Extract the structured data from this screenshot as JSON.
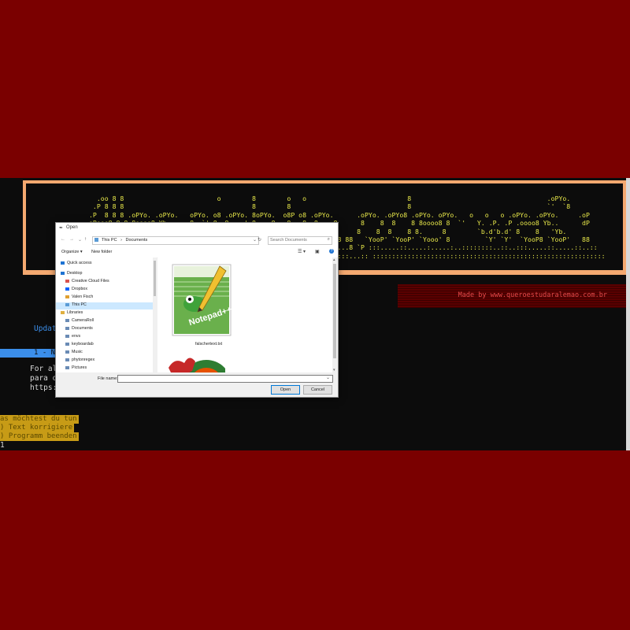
{
  "terminal": {
    "banner_lines": [
      "  .oo 8 8                        o        8        o   o                          8                                   .oPYo.",
      " .P 8 8 8                                 8        8                              8                                   `'  `8",
      ".P  8 8 8 .oPYo. .oPYo.   oPYo. o8 .oPYo. 8oPYo.  o8P o8 .oPYo.      .oPYo. .oPYo8 .oPYo. oPYo.   o   o   o .oPYo. .oPYo.     .oP",
      "oPooo8 8 8 8oooo8 Yb..    8  `' 8  8    ' 8    8   8   8  8    8      8    8  8    8 8oooo8 8  `'   Y. .P. .P .oooo8 Yb..      dP",
      ".P    8 8 8 8.     'Yb.  8     8  8    . 8    8   8   8  8    8      8    8  8    8 8.     8        `b.d'b.d' 8    8   'Yb.",
      ".P     8 8 8 `Yooo' `YooP' 8     8  `YooP' 8    8   8   8  `YooP8 88   `YooP' `YooP' `Yooo' 8         `Y' `Y'  `YooP8 `YooP'   88",
      "..:::::..:..:.....:.....:..:::::..:.....:..:::..:::..:....::..:....8 `P :::.....::.....:.....:..::::::::..::..:::.....::.....::..::",
      ":::::::::::::::::::::::::::::::::::::::::::::::::::::::::::::::::::...:: ::::::::::::::::::::::::::::::::::::::::::::::::::::::::::::"
    ],
    "made_by": "Made by www.queroestudaralemao.com.br",
    "update_line": "Update",
    "menu_highlight": "1 - N",
    "for_line": "For al",
    "para_line": "para o",
    "https_line": "https:",
    "question": "as möchtest du tun",
    "option1": ") Text korrigiere",
    "option2": ") Programm beenden",
    "input_value": "1"
  },
  "dialog": {
    "title": "Open",
    "breadcrumb": [
      "This PC",
      "›",
      "Documents"
    ],
    "search_placeholder": "Search Documents",
    "toolbar": {
      "organize": "Organize ▾",
      "new_folder": "New folder"
    },
    "nav_items": [
      {
        "label": "Quick access",
        "icon": "star-icon",
        "color": "#1e73d2"
      },
      {
        "label": "Desktop",
        "icon": "desktop-icon",
        "color": "#1e73d2"
      },
      {
        "label": "Creative Cloud Files",
        "icon": "cloud-icon",
        "color": "#d9534f"
      },
      {
        "label": "Dropbox",
        "icon": "dropbox-icon",
        "color": "#0061fe"
      },
      {
        "label": "Valen Fisch",
        "icon": "user-icon",
        "color": "#e0a030"
      },
      {
        "label": "This PC",
        "icon": "pc-icon",
        "color": "#5a9bd5",
        "selected": true
      },
      {
        "label": "Libraries",
        "icon": "library-icon",
        "color": "#e0b040"
      },
      {
        "label": "CameraRoll",
        "icon": "folder-icon",
        "color": "#6a8bb5"
      },
      {
        "label": "Documents",
        "icon": "folder-icon",
        "color": "#6a8bb5"
      },
      {
        "label": "envs",
        "icon": "folder-icon",
        "color": "#6a8bb5"
      },
      {
        "label": "keyboardab",
        "icon": "folder-icon",
        "color": "#6a8bb5"
      },
      {
        "label": "Music",
        "icon": "music-icon",
        "color": "#6a8bb5"
      },
      {
        "label": "phytonregex",
        "icon": "folder-icon",
        "color": "#6a8bb5"
      },
      {
        "label": "Pictures",
        "icon": "pictures-icon",
        "color": "#6a8bb5"
      }
    ],
    "file_name": "falschertext.txt",
    "file_name_label": "File name:",
    "file_name_value": "",
    "open_label": "Open",
    "cancel_label": "Cancel"
  }
}
